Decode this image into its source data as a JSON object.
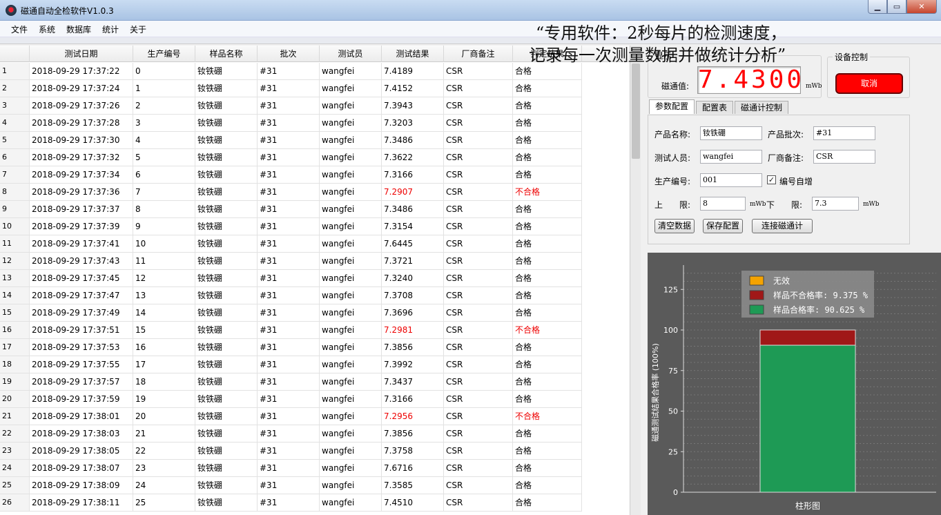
{
  "window": {
    "title": "磁通自动全检软件V1.0.3"
  },
  "menu": [
    "文件",
    "系统",
    "数据库",
    "统计",
    "关于"
  ],
  "overlay": {
    "line1": "“专用软件：2秒每片的检测速度，",
    "line2": "记录每一次测量数据并做统计分析”"
  },
  "table": {
    "headers": [
      "测试日期",
      "生产编号",
      "样品名称",
      "批次",
      "测试员",
      "测试结果",
      "厂商备注",
      "判定结果"
    ],
    "rows": [
      [
        "1",
        "2018-09-29 17:37:22",
        "0",
        "钕铁硼",
        "#31",
        "wangfei",
        "7.4189",
        "CSR",
        "合格"
      ],
      [
        "2",
        "2018-09-29 17:37:24",
        "1",
        "钕铁硼",
        "#31",
        "wangfei",
        "7.4152",
        "CSR",
        "合格"
      ],
      [
        "3",
        "2018-09-29 17:37:26",
        "2",
        "钕铁硼",
        "#31",
        "wangfei",
        "7.3943",
        "CSR",
        "合格"
      ],
      [
        "4",
        "2018-09-29 17:37:28",
        "3",
        "钕铁硼",
        "#31",
        "wangfei",
        "7.3203",
        "CSR",
        "合格"
      ],
      [
        "5",
        "2018-09-29 17:37:30",
        "4",
        "钕铁硼",
        "#31",
        "wangfei",
        "7.3486",
        "CSR",
        "合格"
      ],
      [
        "6",
        "2018-09-29 17:37:32",
        "5",
        "钕铁硼",
        "#31",
        "wangfei",
        "7.3622",
        "CSR",
        "合格"
      ],
      [
        "7",
        "2018-09-29 17:37:34",
        "6",
        "钕铁硼",
        "#31",
        "wangfei",
        "7.3166",
        "CSR",
        "合格"
      ],
      [
        "8",
        "2018-09-29 17:37:36",
        "7",
        "钕铁硼",
        "#31",
        "wangfei",
        "7.2907",
        "CSR",
        "不合格"
      ],
      [
        "9",
        "2018-09-29 17:37:37",
        "8",
        "钕铁硼",
        "#31",
        "wangfei",
        "7.3486",
        "CSR",
        "合格"
      ],
      [
        "10",
        "2018-09-29 17:37:39",
        "9",
        "钕铁硼",
        "#31",
        "wangfei",
        "7.3154",
        "CSR",
        "合格"
      ],
      [
        "11",
        "2018-09-29 17:37:41",
        "10",
        "钕铁硼",
        "#31",
        "wangfei",
        "7.6445",
        "CSR",
        "合格"
      ],
      [
        "12",
        "2018-09-29 17:37:43",
        "11",
        "钕铁硼",
        "#31",
        "wangfei",
        "7.3721",
        "CSR",
        "合格"
      ],
      [
        "13",
        "2018-09-29 17:37:45",
        "12",
        "钕铁硼",
        "#31",
        "wangfei",
        "7.3240",
        "CSR",
        "合格"
      ],
      [
        "14",
        "2018-09-29 17:37:47",
        "13",
        "钕铁硼",
        "#31",
        "wangfei",
        "7.3708",
        "CSR",
        "合格"
      ],
      [
        "15",
        "2018-09-29 17:37:49",
        "14",
        "钕铁硼",
        "#31",
        "wangfei",
        "7.3696",
        "CSR",
        "合格"
      ],
      [
        "16",
        "2018-09-29 17:37:51",
        "15",
        "钕铁硼",
        "#31",
        "wangfei",
        "7.2981",
        "CSR",
        "不合格"
      ],
      [
        "17",
        "2018-09-29 17:37:53",
        "16",
        "钕铁硼",
        "#31",
        "wangfei",
        "7.3856",
        "CSR",
        "合格"
      ],
      [
        "18",
        "2018-09-29 17:37:55",
        "17",
        "钕铁硼",
        "#31",
        "wangfei",
        "7.3992",
        "CSR",
        "合格"
      ],
      [
        "19",
        "2018-09-29 17:37:57",
        "18",
        "钕铁硼",
        "#31",
        "wangfei",
        "7.3437",
        "CSR",
        "合格"
      ],
      [
        "20",
        "2018-09-29 17:37:59",
        "19",
        "钕铁硼",
        "#31",
        "wangfei",
        "7.3166",
        "CSR",
        "合格"
      ],
      [
        "21",
        "2018-09-29 17:38:01",
        "20",
        "钕铁硼",
        "#31",
        "wangfei",
        "7.2956",
        "CSR",
        "不合格"
      ],
      [
        "22",
        "2018-09-29 17:38:03",
        "21",
        "钕铁硼",
        "#31",
        "wangfei",
        "7.3856",
        "CSR",
        "合格"
      ],
      [
        "23",
        "2018-09-29 17:38:05",
        "22",
        "钕铁硼",
        "#31",
        "wangfei",
        "7.3758",
        "CSR",
        "合格"
      ],
      [
        "24",
        "2018-09-29 17:38:07",
        "23",
        "钕铁硼",
        "#31",
        "wangfei",
        "7.6716",
        "CSR",
        "合格"
      ],
      [
        "25",
        "2018-09-29 17:38:09",
        "24",
        "钕铁硼",
        "#31",
        "wangfei",
        "7.3585",
        "CSR",
        "合格"
      ],
      [
        "26",
        "2018-09-29 17:38:11",
        "25",
        "钕铁硼",
        "#31",
        "wangfei",
        "7.4510",
        "CSR",
        "合格"
      ]
    ],
    "fail_value": "不合格"
  },
  "flux": {
    "group_title": "显示",
    "label": "磁通值:",
    "value": "7.4300",
    "unit": "mWb"
  },
  "device": {
    "group_title": "设备控制",
    "cancel_label": "取消"
  },
  "tabs": [
    "参数配置",
    "配置表",
    "磁通计控制"
  ],
  "config": {
    "product_name_label": "产品名称:",
    "product_name": "钕铁硼",
    "batch_label": "产品批次:",
    "batch": "#31",
    "tester_label": "测试人员:",
    "tester": "wangfei",
    "vendor_label": "厂商备注:",
    "vendor": "CSR",
    "serial_label": "生产编号:",
    "serial": "001",
    "auto_increment_label": "编号自增",
    "upper_label": "上　　限:",
    "upper": "8",
    "lower_label": "下　　限:",
    "lower": "7.3",
    "unit": "mWb",
    "clear_label": "清空数据",
    "save_label": "保存配置",
    "connect_label": "连接磁通计"
  },
  "chart_data": {
    "type": "bar",
    "categories": [
      "柱形图"
    ],
    "series": [
      {
        "name": "样品合格率: 90.625 %",
        "values": [
          90.625
        ],
        "color": "#1e9a55"
      },
      {
        "name": "样品不合格率: 9.375 %",
        "values": [
          9.375
        ],
        "color": "#a01818"
      },
      {
        "name": "无效",
        "values": [
          0
        ],
        "color": "#f5a300"
      }
    ],
    "stacked": true,
    "ylabel": "磁通测试结果合格率 (100%)",
    "ylim": [
      0,
      140
    ],
    "yticks": [
      0,
      25,
      50,
      75,
      100,
      125
    ],
    "legend": "top-right",
    "grid": true
  }
}
